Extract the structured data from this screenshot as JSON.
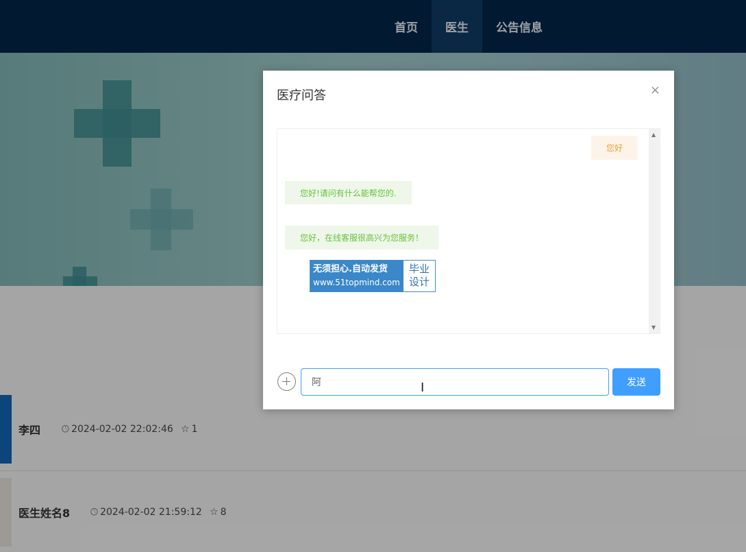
{
  "nav": {
    "items": [
      {
        "label": "首页",
        "active": false
      },
      {
        "label": "医生",
        "active": true
      },
      {
        "label": "公告信息",
        "active": false
      }
    ]
  },
  "doctors": [
    {
      "name": "李四",
      "time": "2024-02-02 22:02:46",
      "favorites": "1"
    },
    {
      "name": "医生姓名8",
      "time": "2024-02-02 21:59:12",
      "favorites": "8"
    }
  ],
  "modal": {
    "title": "医疗问答",
    "close_icon": "×",
    "messages": [
      {
        "role": "user",
        "text": "您好"
      },
      {
        "role": "bot",
        "text": "您好!请问有什么能帮您的."
      },
      {
        "role": "bot",
        "text": "您好，在线客服很高兴为您服务！"
      }
    ],
    "promo": {
      "line1": "无须担心.自动发货",
      "line2": "www.51topmind.com",
      "side_line1": "毕业",
      "side_line2": "设计"
    },
    "input_value": "阿",
    "send_label": "发送"
  },
  "icons": {
    "clock": "clock-icon",
    "star": "star-icon",
    "add": "plus-circle-icon",
    "close": "close-icon"
  },
  "colors": {
    "nav_bg": "#04254a",
    "primary": "#409eff",
    "user_msg": "#e6a23c",
    "bot_msg": "#67c23a"
  }
}
